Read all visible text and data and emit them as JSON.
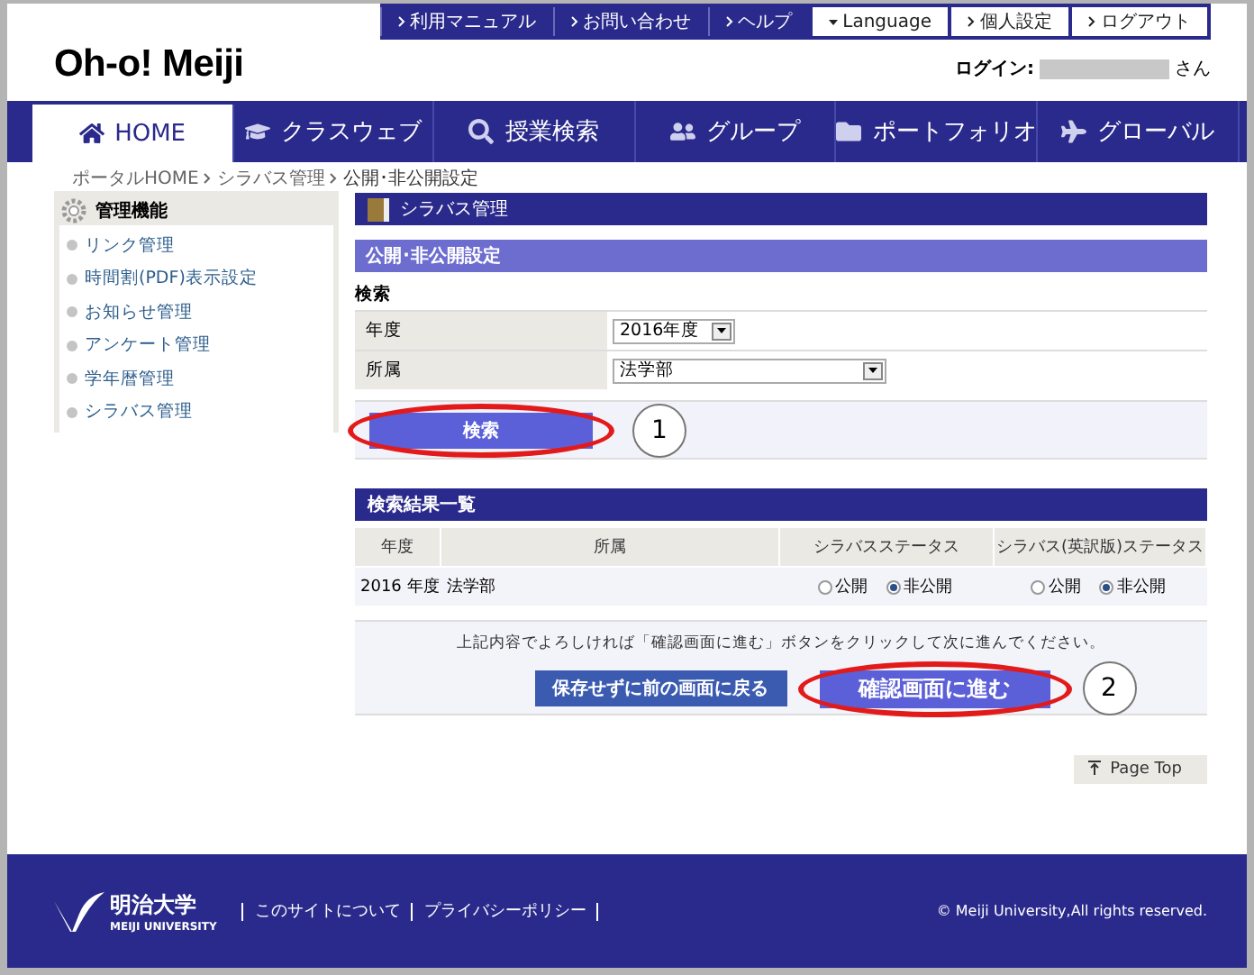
{
  "logo": "Oh-o! Meiji",
  "top_links": [
    {
      "label": "利用マニュアル",
      "kind": "dark"
    },
    {
      "label": "お問い合わせ",
      "kind": "dark"
    },
    {
      "label": "ヘルプ",
      "kind": "dark"
    },
    {
      "label": "Language",
      "kind": "dropdown"
    },
    {
      "label": "個人設定",
      "kind": "light"
    },
    {
      "label": "ログアウト",
      "kind": "light"
    }
  ],
  "login": {
    "label": "ログイン:",
    "suffix": "さん"
  },
  "nav": [
    {
      "label": "HOME",
      "selected": true
    },
    {
      "label": "クラスウェブ",
      "selected": false
    },
    {
      "label": "授業検索",
      "selected": false
    },
    {
      "label": "グループ",
      "selected": false
    },
    {
      "label": "ポートフォリオ",
      "selected": false
    },
    {
      "label": "グローバル",
      "selected": false
    }
  ],
  "breadcrumb": [
    "ポータルHOME",
    "シラバス管理",
    "公開･非公開設定"
  ],
  "sidebar": {
    "title": "管理機能",
    "items": [
      "リンク管理",
      "時間割(PDF)表示設定",
      "お知らせ管理",
      "アンケート管理",
      "学年暦管理",
      "シラバス管理"
    ]
  },
  "section_title": "シラバス管理",
  "subsection_title": "公開･非公開設定",
  "search": {
    "heading": "検索",
    "fields": [
      {
        "label": "年度",
        "value": "2016年度"
      },
      {
        "label": "所属",
        "value": "法学部"
      }
    ],
    "button": "検索",
    "marker": "1"
  },
  "results": {
    "title": "検索結果一覧",
    "columns": [
      "年度",
      "所属",
      "シラバスステータス",
      "シラバス(英訳版)ステータス"
    ],
    "rows": [
      {
        "year": "2016 年度",
        "faculty": "法学部",
        "statuses": [
          [
            {
              "label": "公開",
              "selected": false
            },
            {
              "label": "非公開",
              "selected": true
            }
          ],
          [
            {
              "label": "公開",
              "selected": false
            },
            {
              "label": "非公開",
              "selected": true
            }
          ]
        ]
      }
    ]
  },
  "confirm": {
    "message": "上記内容でよろしければ「確認画面に進む」ボタンをクリックして次に進んでください。",
    "back_button": "保存せずに前の画面に戻る",
    "next_button": "確認画面に進む",
    "marker": "2"
  },
  "page_top": "Page Top",
  "footer": {
    "logo_main": "明治大学",
    "logo_sub": "MEIJI UNIVERSITY",
    "links": [
      "このサイトについて",
      "プライバシーポリシー"
    ],
    "copyright": "© Meiji University,All rights reserved."
  }
}
